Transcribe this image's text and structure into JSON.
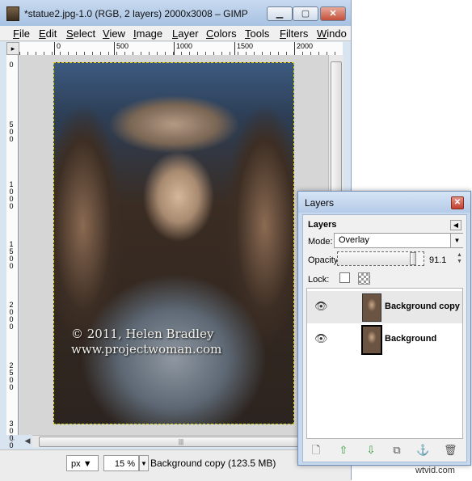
{
  "window": {
    "title": "*statue2.jpg-1.0 (RGB, 2 layers) 2000x3008 – GIMP",
    "minimize_icon": "minimize-icon",
    "maximize_icon": "maximize-icon",
    "close_icon": "close-icon"
  },
  "menu": {
    "items": [
      "File",
      "Edit",
      "Select",
      "View",
      "Image",
      "Layer",
      "Colors",
      "Tools",
      "Filters",
      "Windo"
    ]
  },
  "rulers": {
    "horizontal_labels": [
      "0",
      "500",
      "1000",
      "1500",
      "2000"
    ],
    "vertical_labels": [
      "0",
      "500",
      "1000",
      "1500",
      "2000",
      "2500",
      "3000"
    ]
  },
  "canvas": {
    "watermark_line1": "© 2011, Helen Bradley",
    "watermark_line2": "www.projectwoman.com"
  },
  "statusbar": {
    "unit": "px",
    "zoom": "15 %",
    "status": "Background copy (123.5 MB)"
  },
  "layers_dialog": {
    "title": "Layers",
    "tab_label": "Layers",
    "mode_label": "Mode:",
    "mode_value": "Overlay",
    "opacity_label": "Opacity:",
    "opacity_value": "91.1",
    "opacity_fraction": 0.911,
    "lock_label": "Lock:",
    "layers": [
      {
        "name": "Background copy",
        "visible": true,
        "active": true
      },
      {
        "name": "Background",
        "visible": true,
        "active": false
      }
    ],
    "toolbar_icons": [
      "new-layer-icon",
      "raise-layer-icon",
      "lower-layer-icon",
      "duplicate-layer-icon",
      "anchor-layer-icon",
      "delete-layer-icon"
    ]
  },
  "credit": "wtvid.com",
  "colors": {
    "accent": "#c7d9ef",
    "raise_arrow": "#3a9a3a",
    "close_red": "#c4503a"
  }
}
